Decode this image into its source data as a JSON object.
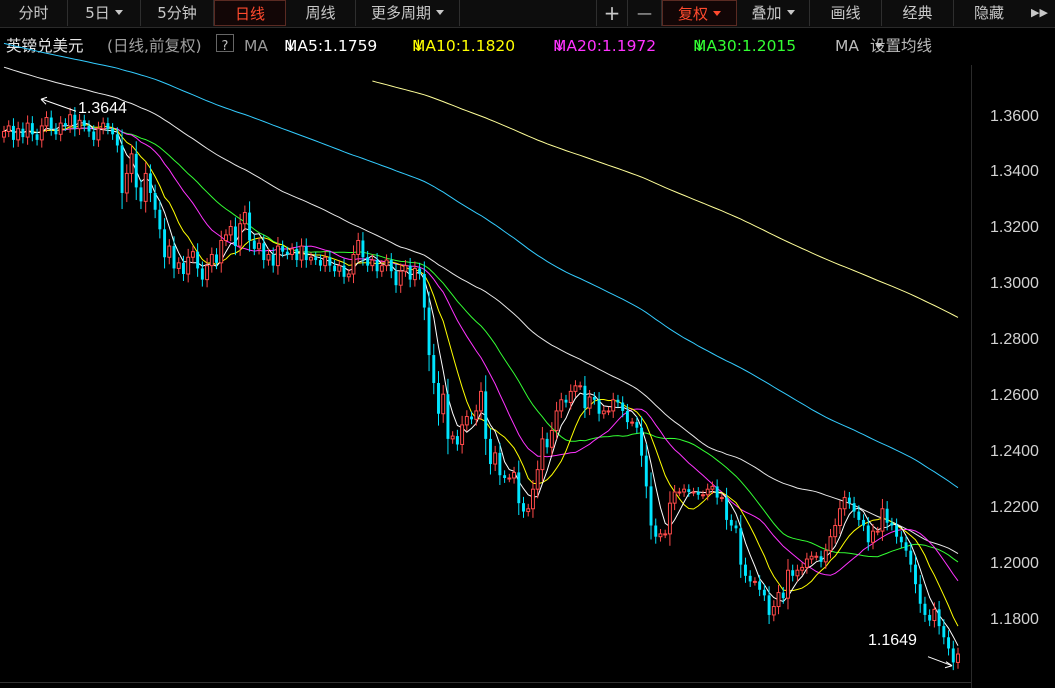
{
  "toolbar": {
    "items": [
      {
        "label": "分时",
        "active": false,
        "dropdown": false
      },
      {
        "label": "5日",
        "active": false,
        "dropdown": true
      },
      {
        "label": "5分钟",
        "active": false,
        "dropdown": false
      },
      {
        "label": "日线",
        "active": true,
        "dropdown": false
      },
      {
        "label": "周线",
        "active": false,
        "dropdown": false
      },
      {
        "label": "更多周期",
        "active": false,
        "dropdown": true
      }
    ],
    "plus": "+",
    "minus": "—",
    "fuquan": "复权",
    "diejia": "叠加",
    "huaxian": "画线",
    "jingdian": "经典",
    "yincang": "隐藏",
    "more": "▶▶"
  },
  "legend": {
    "symbol": "英镑兑美元",
    "period": "(日线,前复权)",
    "help": "?",
    "ma_label": "MA",
    "ma5": "MA5:1.1759",
    "ma10": "MA10:1.1820",
    "ma20": "MA20:1.1972",
    "ma30": "MA30:1.2015",
    "ma_more": "MA",
    "settings": "设置均线",
    "down_arrow": "↓",
    "colors": {
      "ma5": "#ffffff",
      "ma10": "#ffff00",
      "ma20": "#ff33ff",
      "ma30": "#33ff33"
    }
  },
  "annotations": {
    "high": "1.3644",
    "low": "1.1649"
  },
  "colors": {
    "up": "#ff4a4a",
    "down": "#00e5ff",
    "ma60": "#e8e8e8",
    "ma120": "#33ccff",
    "ma250": "#ffff99"
  },
  "chart_data": {
    "type": "candlestick",
    "ylim": [
      1.158,
      1.372
    ],
    "yticks": [
      "1.3600",
      "1.3400",
      "1.3200",
      "1.3000",
      "1.2800",
      "1.2600",
      "1.2400",
      "1.2200",
      "1.2000",
      "1.1800"
    ],
    "high_value": 1.3644,
    "low_value": 1.1649,
    "closes": [
      1.355,
      1.357,
      1.352,
      1.356,
      1.353,
      1.358,
      1.354,
      1.352,
      1.357,
      1.36,
      1.356,
      1.354,
      1.358,
      1.357,
      1.361,
      1.356,
      1.359,
      1.357,
      1.355,
      1.352,
      1.356,
      1.358,
      1.356,
      1.354,
      1.35,
      1.333,
      1.34,
      1.347,
      1.335,
      1.33,
      1.34,
      1.333,
      1.327,
      1.32,
      1.31,
      1.314,
      1.306,
      1.308,
      1.304,
      1.31,
      1.312,
      1.306,
      1.302,
      1.307,
      1.311,
      1.308,
      1.316,
      1.318,
      1.321,
      1.314,
      1.322,
      1.326,
      1.316,
      1.313,
      1.315,
      1.309,
      1.311,
      1.307,
      1.314,
      1.312,
      1.311,
      1.313,
      1.309,
      1.314,
      1.309,
      1.31,
      1.309,
      1.307,
      1.31,
      1.307,
      1.305,
      1.307,
      1.303,
      1.304,
      1.311,
      1.316,
      1.31,
      1.307,
      1.309,
      1.305,
      1.307,
      1.309,
      1.305,
      1.3,
      1.305,
      1.307,
      1.302,
      1.306,
      1.304,
      1.292,
      1.275,
      1.265,
      1.254,
      1.261,
      1.245,
      1.246,
      1.243,
      1.25,
      1.253,
      1.252,
      1.255,
      1.262,
      1.245,
      1.236,
      1.24,
      1.232,
      1.231,
      1.231,
      1.233,
      1.222,
      1.219,
      1.22,
      1.227,
      1.234,
      1.245,
      1.242,
      1.248,
      1.255,
      1.259,
      1.258,
      1.262,
      1.264,
      1.264,
      1.256,
      1.26,
      1.259,
      1.254,
      1.255,
      1.255,
      1.259,
      1.258,
      1.255,
      1.251,
      1.251,
      1.249,
      1.239,
      1.228,
      1.214,
      1.21,
      1.211,
      1.211,
      1.222,
      1.226,
      1.226,
      1.227,
      1.226,
      1.226,
      1.225,
      1.225,
      1.227,
      1.228,
      1.224,
      1.224,
      1.216,
      1.214,
      1.213,
      1.2,
      1.196,
      1.194,
      1.194,
      1.191,
      1.189,
      1.182,
      1.185,
      1.19,
      1.188,
      1.198,
      1.196,
      1.198,
      1.199,
      1.202,
      1.203,
      1.203,
      1.201,
      1.205,
      1.21,
      1.214,
      1.22,
      1.224,
      1.222,
      1.219,
      1.216,
      1.214,
      1.208,
      1.212,
      1.212,
      1.22,
      1.215,
      1.214,
      1.21,
      1.208,
      1.205,
      1.2,
      1.193,
      1.186,
      1.182,
      1.18,
      1.184,
      1.178,
      1.174,
      1.17,
      1.165,
      1.168
    ]
  }
}
